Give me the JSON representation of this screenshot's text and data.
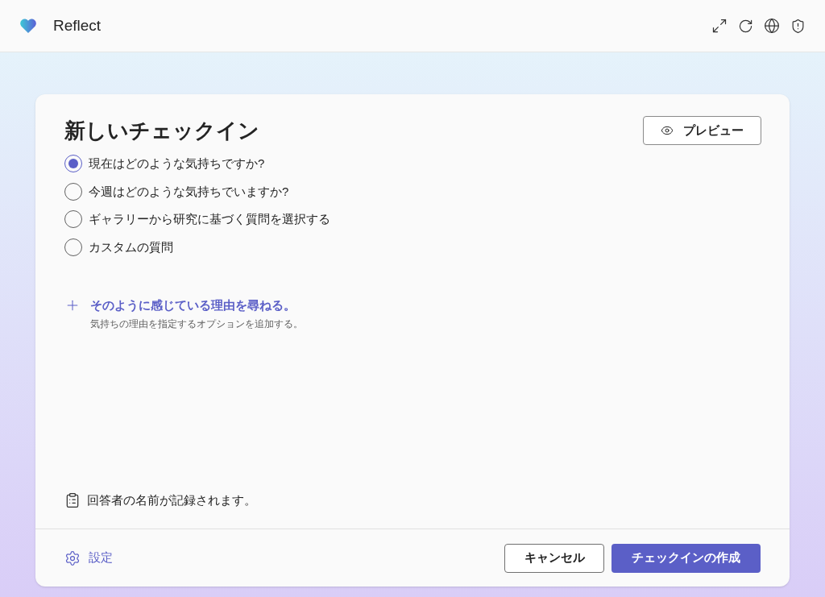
{
  "app": {
    "name": "Reflect"
  },
  "card": {
    "title": "新しいチェックイン",
    "preview_button": "プレビュー",
    "options": [
      {
        "label": "現在はどのような気持ちですか?",
        "selected": true
      },
      {
        "label": "今週はどのような気持ちでいますか?",
        "selected": false
      },
      {
        "label": "ギャラリーから研究に基づく質問を選択する",
        "selected": false
      },
      {
        "label": "カスタムの質問",
        "selected": false
      }
    ],
    "reason": {
      "title": "そのように感じている理由を尋ねる。",
      "description": "気持ちの理由を指定するオプションを追加する。"
    },
    "notice": "回答者の名前が記録されます。",
    "settings": "設定",
    "cancel_button": "キャンセル",
    "create_button": "チェックインの作成"
  }
}
